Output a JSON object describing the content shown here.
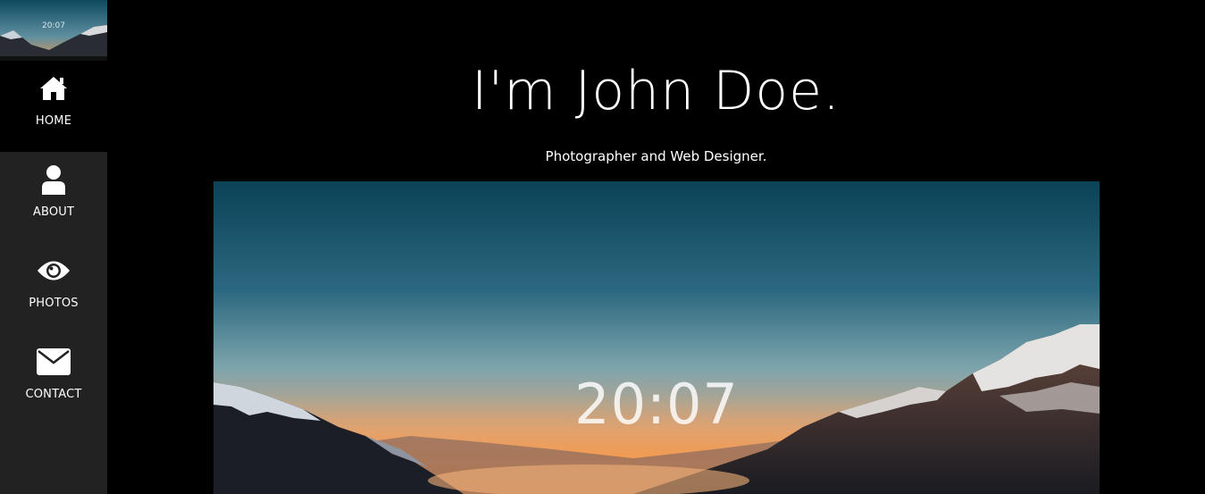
{
  "sidebar": {
    "thumbnail_clock": "20:07",
    "items": [
      {
        "label": "HOME",
        "icon": "home-icon"
      },
      {
        "label": "ABOUT",
        "icon": "user-icon"
      },
      {
        "label": "PHOTOS",
        "icon": "eye-icon"
      },
      {
        "label": "CONTACT",
        "icon": "envelope-icon"
      }
    ],
    "active": "HOME"
  },
  "main": {
    "title": "I'm John Doe.",
    "subtitle": "Photographer and Web Designer.",
    "hero_clock": "20:07"
  },
  "colors": {
    "sidebar_bg": "#222222",
    "page_bg": "#000000",
    "text": "#ffffff"
  }
}
